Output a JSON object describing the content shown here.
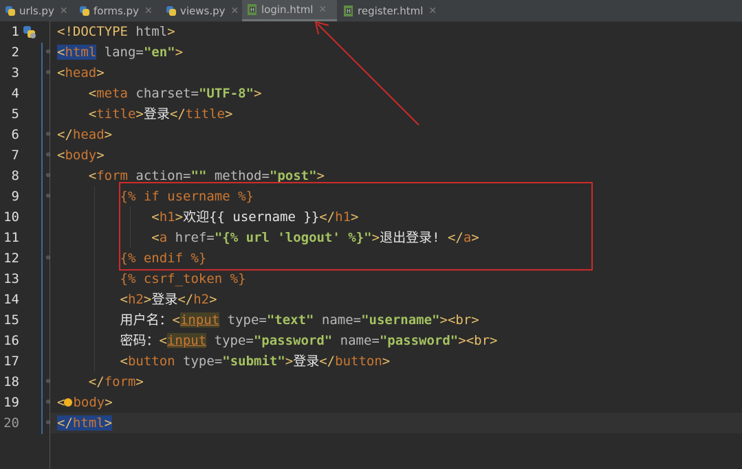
{
  "tabs": [
    {
      "label": "urls.py",
      "icon": "python-file-icon",
      "active": false
    },
    {
      "label": "forms.py",
      "icon": "python-file-icon",
      "active": false
    },
    {
      "label": "views.py",
      "icon": "python-file-icon",
      "active": false
    },
    {
      "label": "login.html",
      "icon": "html-file-icon",
      "active": true
    },
    {
      "label": "register.html",
      "icon": "html-file-icon",
      "active": false
    }
  ],
  "close_glyph": "✕",
  "line_numbers": [
    "1",
    "2",
    "3",
    "4",
    "5",
    "6",
    "7",
    "8",
    "9",
    "10",
    "11",
    "12",
    "13",
    "14",
    "15",
    "16",
    "17",
    "18",
    "19",
    "20"
  ],
  "code": {
    "l1_doctype": "<!DOCTYPE",
    "l1_html": "html",
    "l1_end": ">",
    "l2_lt": "<",
    "l2_tag": "html",
    "l2_attr": " lang=",
    "l2_val": "\"en\"",
    "l2_gt": ">",
    "l3_lt": "<",
    "l3_tag": "head",
    "l3_gt": ">",
    "l4_lt": "<",
    "l4_tag": "meta",
    "l4_attr": " charset=",
    "l4_val": "\"UTF-8\"",
    "l4_gt": ">",
    "l5_open": "<",
    "l5_tag": "title",
    "l5_gt": ">",
    "l5_text": "登录",
    "l5_close": "</",
    "l5_tag2": "title",
    "l5_gt2": ">",
    "l6_lt": "</",
    "l6_tag": "head",
    "l6_gt": ">",
    "l7_lt": "<",
    "l7_tag": "body",
    "l7_gt": ">",
    "l8_lt": "<",
    "l8_tag": "form",
    "l8_attr1": " action=",
    "l8_val1": "\"\"",
    "l8_attr2": " method=",
    "l8_val2": "\"post\"",
    "l8_gt": ">",
    "l9": "{% if username %}",
    "l10_lt": "<",
    "l10_tag": "h1",
    "l10_gt": ">",
    "l10_text": "欢迎{{ username }}",
    "l10_close": "</",
    "l10_tag2": "h1",
    "l10_gt2": ">",
    "l11_lt": "<",
    "l11_tag": "a",
    "l11_attr": " href=",
    "l11_val": "\"{% url 'logout' %}\"",
    "l11_gt": ">",
    "l11_text": "退出登录! ",
    "l11_close": "</",
    "l11_tag2": "a",
    "l11_gt2": ">",
    "l12": "{% endif %}",
    "l13": "{% csrf_token %}",
    "l14_lt": "<",
    "l14_tag": "h2",
    "l14_gt": ">",
    "l14_text": "登录",
    "l14_close": "</",
    "l14_tag2": "h2",
    "l14_gt2": ">",
    "l15_label": "用户名：",
    "l15_lt": "<",
    "l15_tag": "input",
    "l15_attr1": " type=",
    "l15_val1": "\"text\"",
    "l15_attr2": " name=",
    "l15_val2": "\"username\"",
    "l15_end": "><br>",
    "l16_label": "密码：",
    "l16_lt": "<",
    "l16_tag": "input",
    "l16_attr1": " type=",
    "l16_val1": "\"password\"",
    "l16_attr2": " name=",
    "l16_val2": "\"password\"",
    "l16_end": "><br>",
    "l17_lt": "<",
    "l17_tag": "button",
    "l17_attr": " type=",
    "l17_val": "\"submit\"",
    "l17_gt": ">",
    "l17_text": "登录",
    "l17_close": "</",
    "l17_tag2": "button",
    "l17_gt2": ">",
    "l18_lt": "</",
    "l18_tag": "form",
    "l18_gt": ">",
    "l19_lt": "<",
    "l19_tag": "body",
    "l19_gt": ">",
    "l20_lt": "</",
    "l20_tag": "html",
    "l20_gt": ">"
  },
  "colors": {
    "annotation": "#d02a2a",
    "editor_bg": "#2b2b2b",
    "tab_bar_bg": "#3c3f41"
  }
}
